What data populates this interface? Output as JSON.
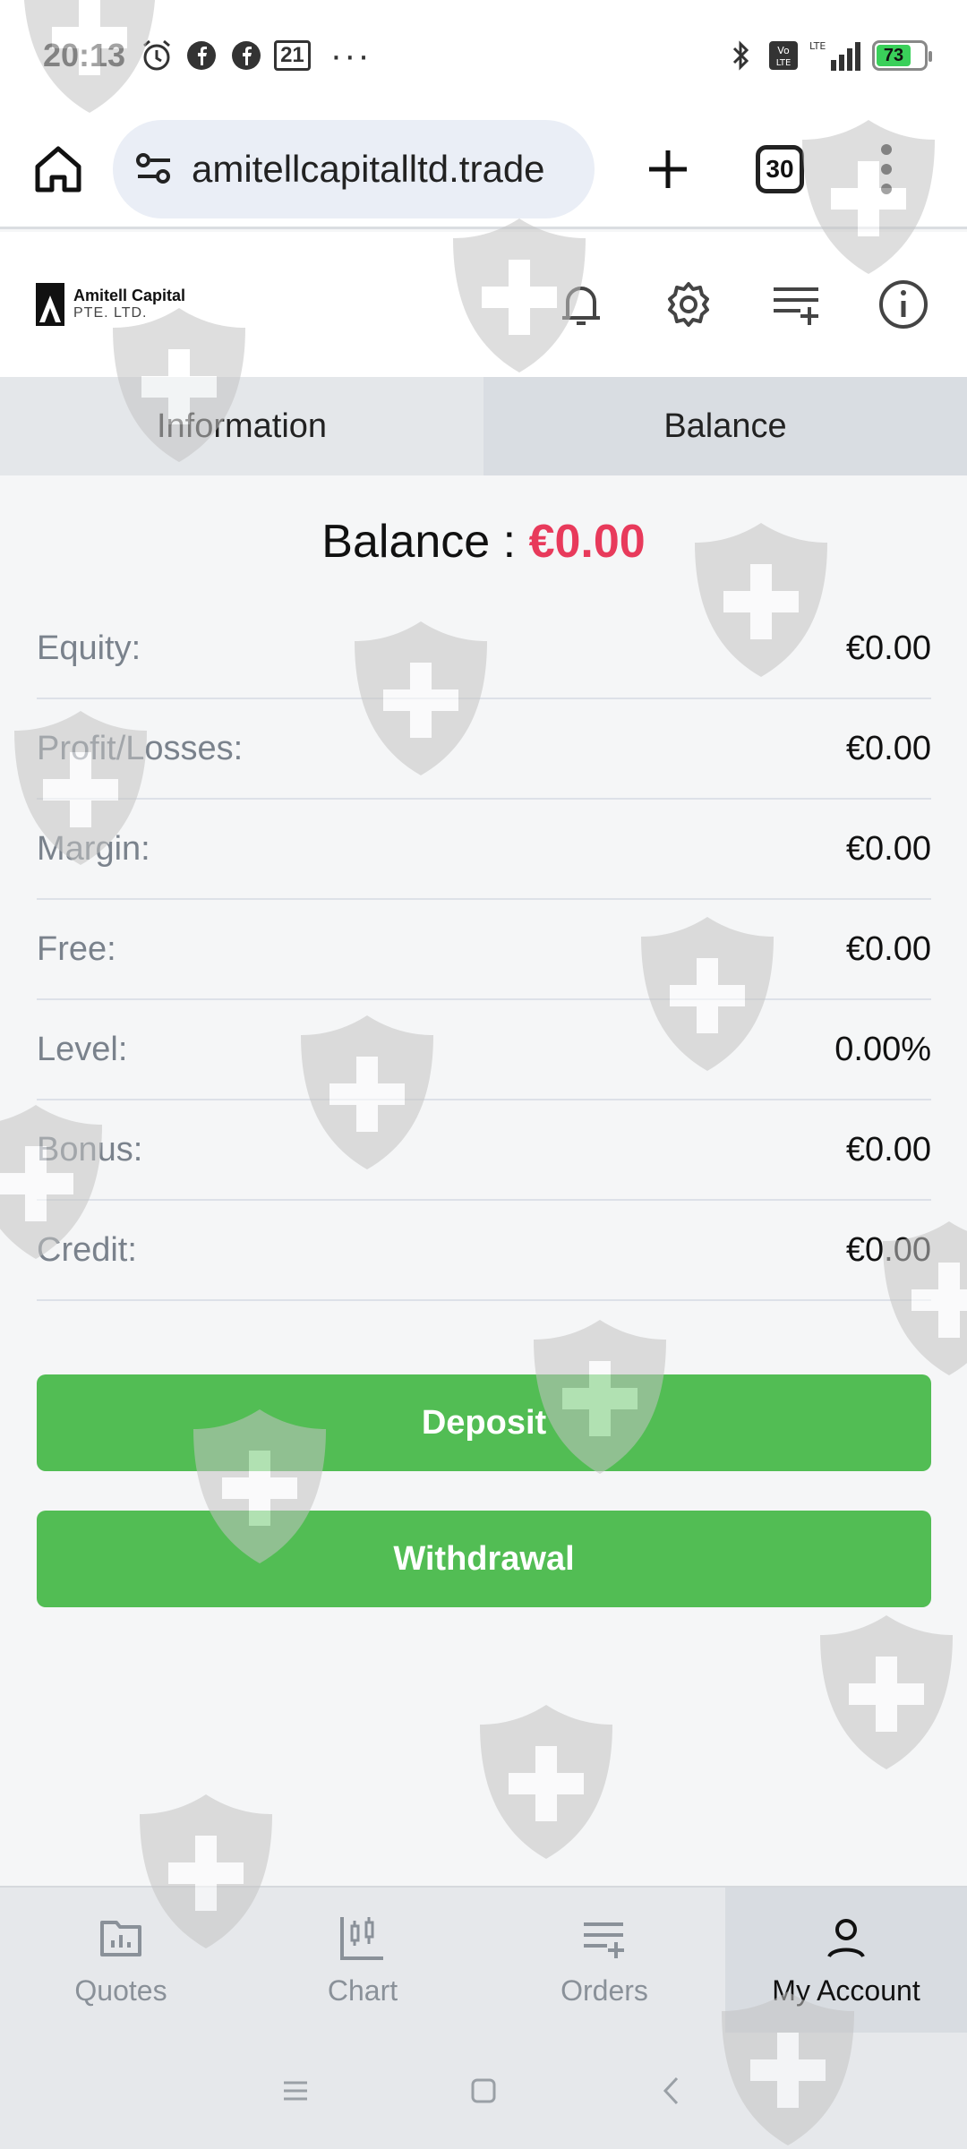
{
  "status_bar": {
    "time": "20:13",
    "notification_count": "21",
    "more": "···",
    "network": "LTE",
    "battery": "73"
  },
  "browser": {
    "url": "amitellcapitalltd.trade",
    "tab_count": "30"
  },
  "app": {
    "logo_name": "Amitell Capital",
    "logo_sub": "PTE. LTD."
  },
  "tabs": [
    {
      "label": "Information",
      "active": false
    },
    {
      "label": "Balance",
      "active": true
    }
  ],
  "balance": {
    "title_label": "Balance : ",
    "title_value": "€0.00",
    "rows": [
      {
        "label": "Equity:",
        "value": "€0.00"
      },
      {
        "label": "Profit/Losses:",
        "value": "€0.00"
      },
      {
        "label": "Margin:",
        "value": "€0.00"
      },
      {
        "label": "Free:",
        "value": "€0.00"
      },
      {
        "label": "Level:",
        "value": "0.00%"
      },
      {
        "label": "Bonus:",
        "value": "€0.00"
      },
      {
        "label": "Credit:",
        "value": "€0.00"
      }
    ],
    "deposit_label": "Deposit",
    "withdrawal_label": "Withdrawal"
  },
  "bottom_nav": [
    {
      "label": "Quotes",
      "icon": "quotes-icon"
    },
    {
      "label": "Chart",
      "icon": "chart-icon"
    },
    {
      "label": "Orders",
      "icon": "orders-icon"
    },
    {
      "label": "My Account",
      "icon": "account-icon",
      "active": true
    }
  ],
  "colors": {
    "accent_green": "#52bd54",
    "balance_red": "#e83a5b"
  }
}
